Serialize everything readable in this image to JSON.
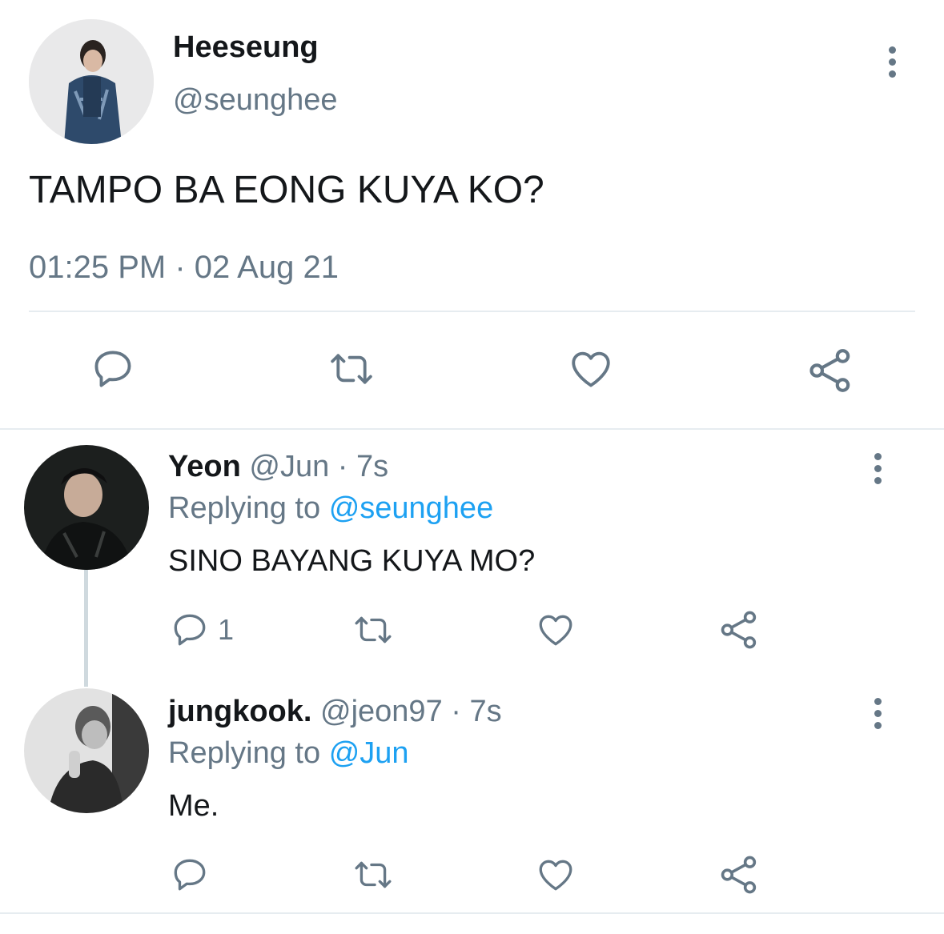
{
  "main_tweet": {
    "display_name": "Heeseung",
    "handle": "@seunghee",
    "text": "TAMPO BA EONG KUYA KO?",
    "timestamp": "01:25 PM · 02 Aug 21"
  },
  "replies": [
    {
      "display_name": "Yeon",
      "handle": "@Jun",
      "time": "· 7s",
      "replying_label": "Replying to",
      "replying_to": "@seunghee",
      "text": "SINO BAYANG KUYA MO?",
      "reply_count": "1"
    },
    {
      "display_name": "jungkook.",
      "handle": "@jeon97",
      "time": "· 7s",
      "replying_label": "Replying to",
      "replying_to": "@Jun",
      "text": "Me."
    }
  ],
  "icons": {
    "reply": "reply-icon",
    "retweet": "retweet-icon",
    "like": "heart-icon",
    "share": "share-icon",
    "more": "more-vertical-icon"
  },
  "colors": {
    "text": "#14171a",
    "muted": "#657786",
    "link": "#1da1f2",
    "divider": "#e6ecf0"
  }
}
